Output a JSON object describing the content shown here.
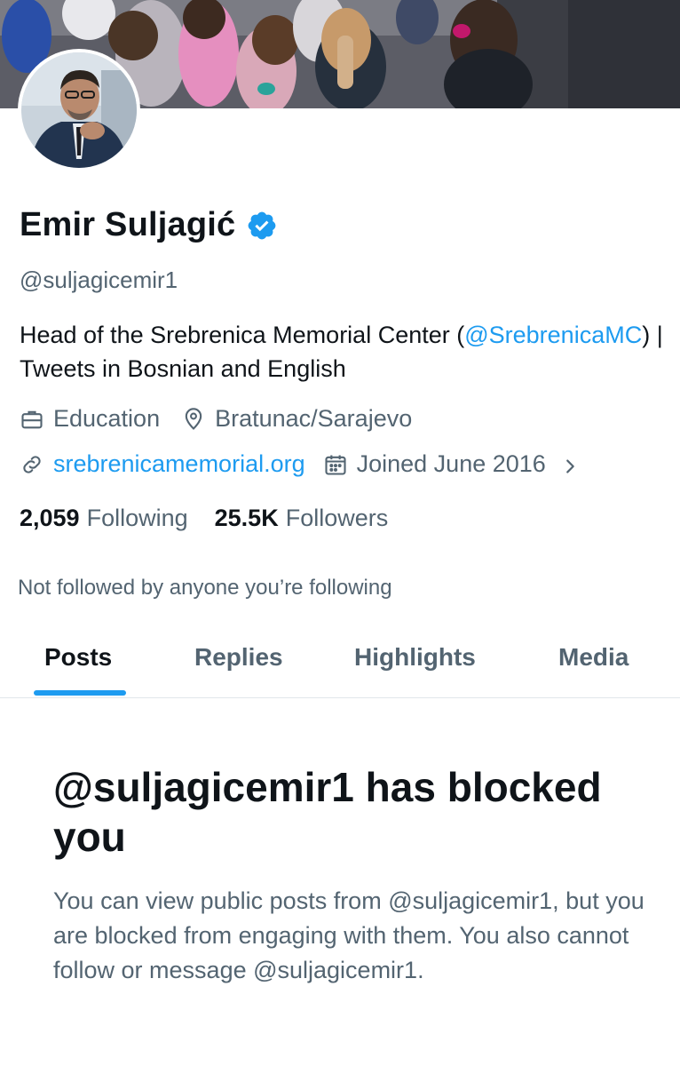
{
  "profile": {
    "name": "Emir Suljagić",
    "handle": "@suljagicemir1",
    "verified": true
  },
  "bio": {
    "prefix": "Head of the Srebrenica Memorial Center (",
    "mention": "@SrebrenicaMC",
    "suffix": ") | Tweets in Bosnian and English"
  },
  "meta": {
    "category": "Education",
    "location": "Bratunac/Sarajevo",
    "website": "srebrenicamemorial.org",
    "joined": "Joined June 2016"
  },
  "stats": {
    "following_count": "2,059",
    "following_label": "Following",
    "followers_count": "25.5K",
    "followers_label": "Followers"
  },
  "followed_by": "Not followed by anyone you’re following",
  "tabs": [
    "Posts",
    "Replies",
    "Highlights",
    "Media"
  ],
  "active_tab": "Posts",
  "blocked": {
    "title": "@suljagicemir1 has blocked you",
    "body": "You can view public posts from @suljagicemir1, but you are blocked from engaging with them. You also cannot follow or message @suljagicemir1."
  },
  "colors": {
    "accent": "#1d9bf0",
    "text_primary": "#0f1419",
    "text_secondary": "#536471",
    "divider": "#e1e6ea"
  },
  "icons": {
    "verified": "verified-badge-icon",
    "category": "briefcase-icon",
    "location": "location-pin-icon",
    "website": "link-icon",
    "joined": "calendar-icon",
    "more": "chevron-right-icon"
  }
}
